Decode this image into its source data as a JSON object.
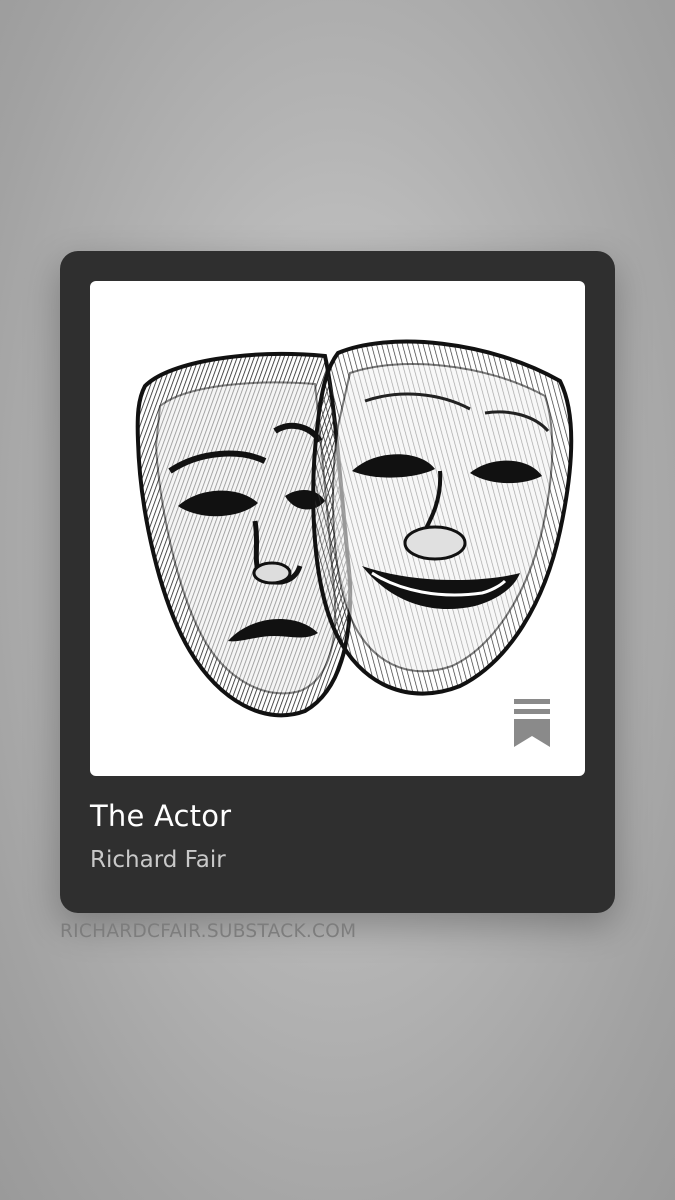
{
  "card": {
    "title": "The Actor",
    "author": "Richard Fair",
    "cover_image": "comedy-tragedy-masks",
    "badge_icon": "substack-bookmark-icon"
  },
  "site_url": "RICHARDCFAIR.SUBSTACK.COM",
  "colors": {
    "card_background": "#2f2f2f",
    "title_text": "#ffffff",
    "author_text": "#c9c9c9",
    "site_text": "#7d7d7d"
  }
}
